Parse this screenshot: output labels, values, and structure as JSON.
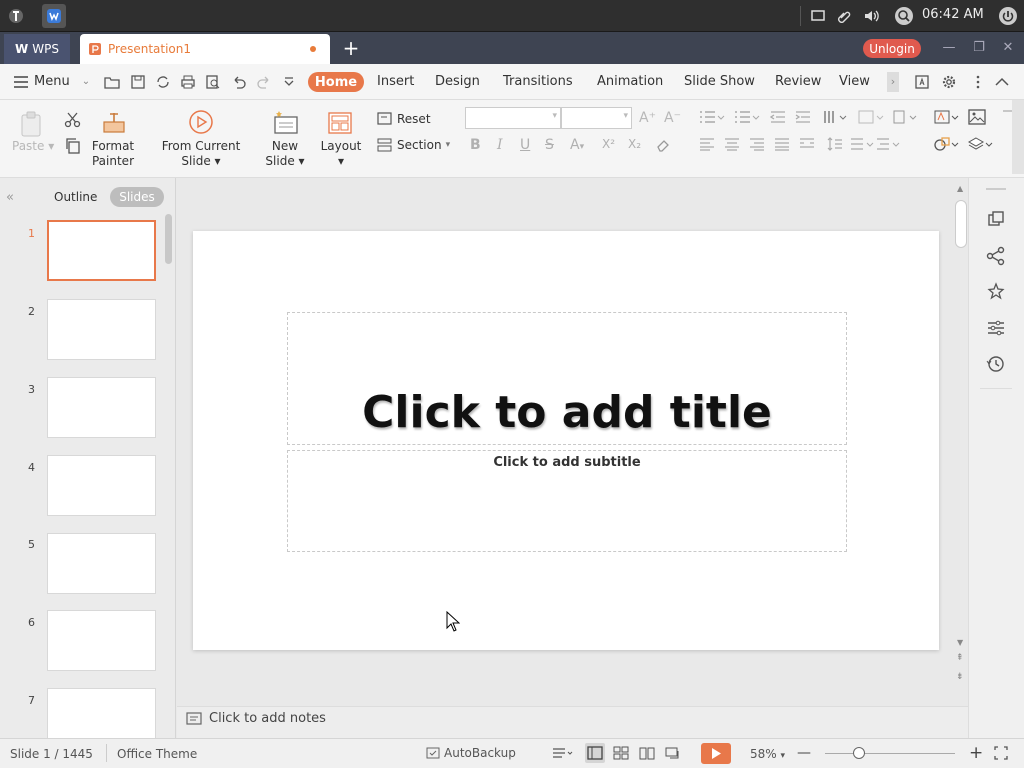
{
  "system": {
    "clock": "06:42 AM"
  },
  "titlebar": {
    "app_tab": "WPS",
    "doc_tab": "Presentation1",
    "new_tab": "+",
    "unlogin": "Unlogin"
  },
  "menu": {
    "menu_label": "Menu",
    "tabs": [
      "Home",
      "Insert",
      "Design",
      "Transitions",
      "Animation",
      "Slide Show",
      "Review",
      "View"
    ]
  },
  "ribbon": {
    "paste": "Paste",
    "format_painter_1": "Format",
    "format_painter_2": "Painter",
    "from_current_1": "From Current",
    "from_current_2": "Slide",
    "new_slide_1": "New",
    "new_slide_2": "Slide",
    "layout": "Layout",
    "reset": "Reset",
    "section": "Section",
    "font_name": "",
    "font_size": ""
  },
  "panel": {
    "outline_tab": "Outline",
    "slides_tab": "Slides",
    "thumbnails": [
      "1",
      "2",
      "3",
      "4",
      "5",
      "6",
      "7"
    ]
  },
  "slide": {
    "title_placeholder": "Click to add title",
    "subtitle_placeholder": "Click to add subtitle"
  },
  "notes": {
    "placeholder": "Click to add notes"
  },
  "status": {
    "slide_counter": "Slide 1 / 1445",
    "theme": "Office Theme",
    "autobackup": "AutoBackup",
    "zoom": "58%"
  },
  "colors": {
    "accent": "#e8784a",
    "unlogin": "#e05a4e",
    "titlebar": "#3e4452"
  }
}
